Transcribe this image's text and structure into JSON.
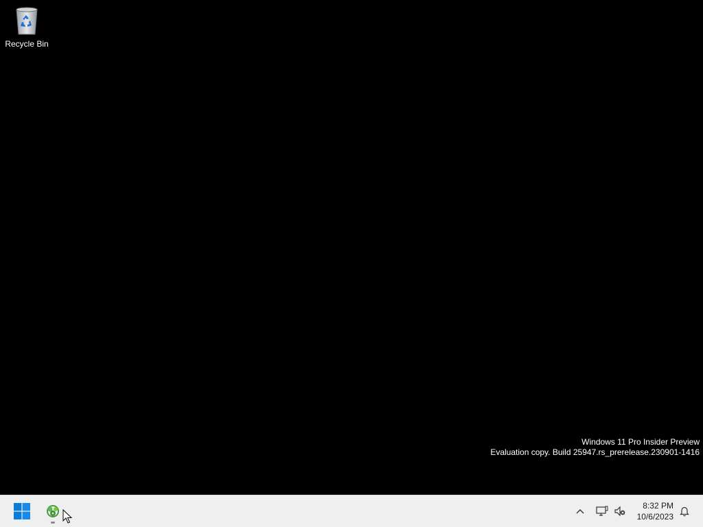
{
  "desktop": {
    "icons": [
      {
        "label": "Recycle Bin",
        "icon": "recycle-bin-icon"
      }
    ],
    "watermark": {
      "line1": "Windows 11 Pro Insider Preview",
      "line2": "Evaluation copy. Build 25947.rs_prerelease.230901-1416"
    }
  },
  "taskbar": {
    "start_icon": "windows-start-icon",
    "pinned_apps": [
      {
        "icon": "app-icon",
        "running": true
      }
    ],
    "tray": {
      "chevron_icon": "chevron-up-icon",
      "network_icon": "network-icon",
      "volume_icon": "volume-muted-icon",
      "notification_icon": "bell-icon"
    },
    "clock": {
      "time": "8:32 PM",
      "date": "10/6/2023"
    }
  },
  "colors": {
    "desktop_background": "#000000",
    "taskbar_background": "#efefef",
    "start_blue": "#0a7bd6"
  }
}
